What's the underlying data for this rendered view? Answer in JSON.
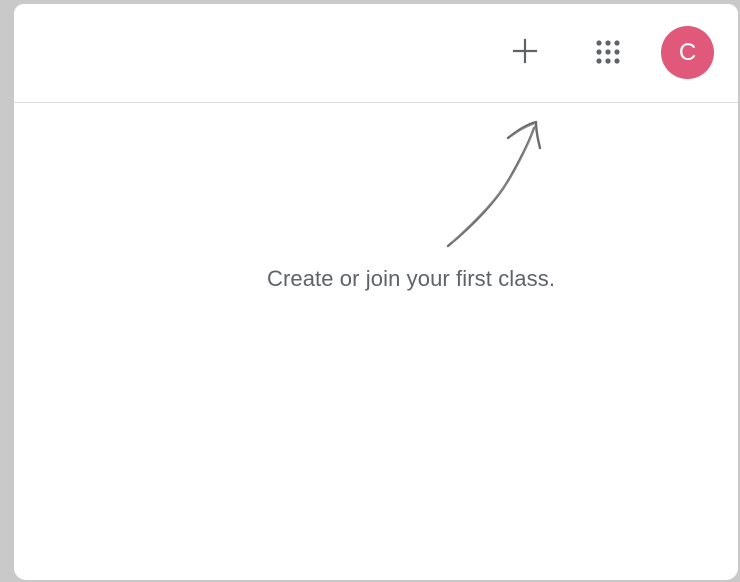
{
  "header": {
    "add_icon": "plus-icon",
    "apps_icon": "grid-icon",
    "avatar_initial": "C",
    "avatar_color": "#e0587a"
  },
  "main": {
    "empty_message": "Create or join your first class.",
    "arrow_icon": "hand-drawn-arrow-icon"
  },
  "colors": {
    "text": "#5f6368",
    "icon": "#5f6368",
    "divider": "#dadce0",
    "background": "#ffffff"
  }
}
